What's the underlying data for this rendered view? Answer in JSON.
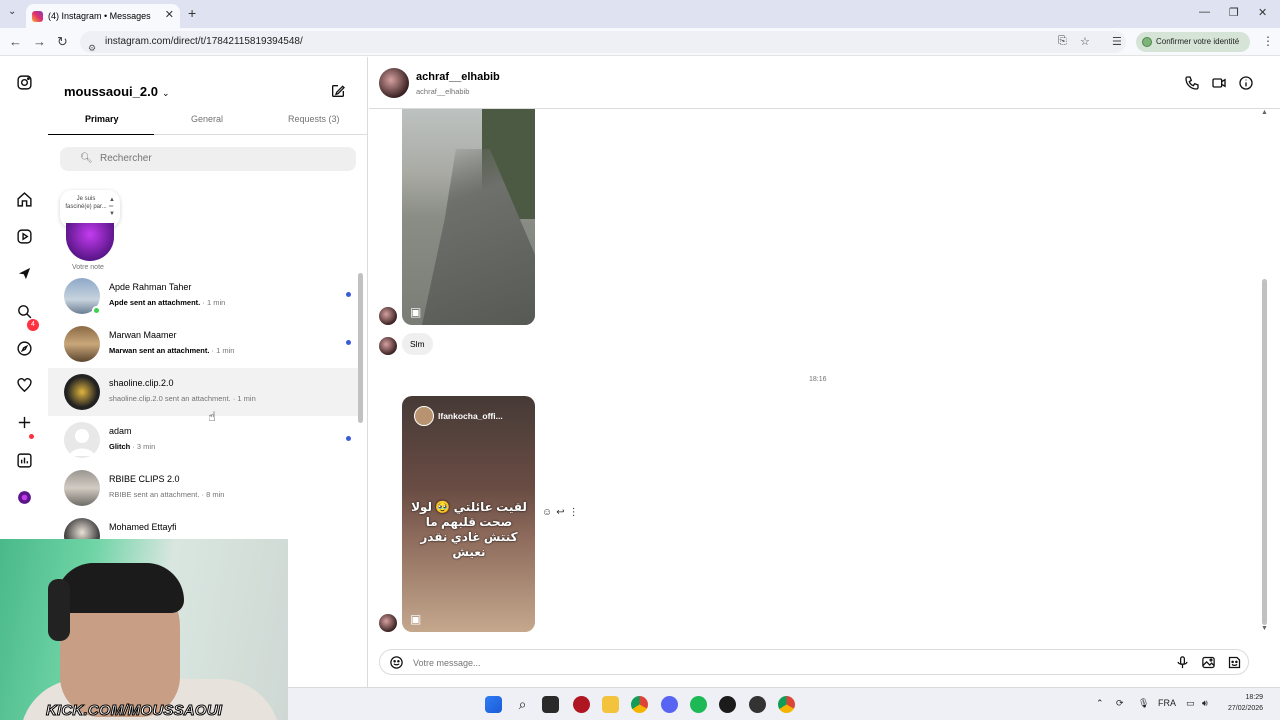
{
  "browser": {
    "tab_title": "(4) Instagram • Messages",
    "url": "instagram.com/direct/t/17842115819394548/",
    "confirm_identity": "Confirmer votre identité"
  },
  "sidebar": {
    "notification_count": "4",
    "icons": [
      "instagram-icon",
      "home-icon",
      "reels-icon",
      "messenger-icon",
      "search-icon",
      "explore-icon",
      "heart-icon",
      "create-icon",
      "dashboard-icon",
      "profile-icon"
    ]
  },
  "inbox": {
    "username": "moussaoui_2.0",
    "tabs": [
      "Primary",
      "General",
      "Requests (3)"
    ],
    "search_placeholder": "Rechercher",
    "note_text": "Je suis fasciné(e) par...",
    "note_label": "Votre note",
    "conversations": [
      {
        "name": "Apde Rahman Taher",
        "preview": "Apde sent an attachment.",
        "time": " · 1 min",
        "unread": true,
        "online": true
      },
      {
        "name": "Marwan Maamer",
        "preview": "Marwan sent an attachment.",
        "time": " · 1 min",
        "unread": true,
        "online": false
      },
      {
        "name": "shaoline.clip.2.0",
        "preview": "shaoline.clip.2.0 sent an attachment.",
        "time": " · 1 min",
        "unread": false,
        "online": false
      },
      {
        "name": "adam",
        "preview": "Glitch",
        "time": " · 3 min",
        "unread": true,
        "online": false
      },
      {
        "name": "RBIBE CLIPS 2.0",
        "preview": "RBIBE sent an attachment.",
        "time": " · 8 min",
        "unread": false,
        "online": false
      },
      {
        "name": "Mohamed Ettayfi",
        "preview": "",
        "time": "",
        "unread": false,
        "online": false
      }
    ]
  },
  "chat": {
    "contact_name": "achraf__elhabib",
    "contact_handle": "achraf__elhabib",
    "message_text": "Slm",
    "timestamp": "18:16",
    "reel2_account": "lfankocha_offi...",
    "reel2_caption": "لقيت عائلتي 🥹 لولا صحت قلبهم ما كنتش غادي نقدر نعيش",
    "composer_placeholder": "Votre message..."
  },
  "overlay": {
    "stream_text": "KICK.COM/MOUSSAOUI"
  },
  "taskbar": {
    "language": "FRA",
    "time": "18:29",
    "date": "27/02/2026"
  },
  "colors": {
    "unread_dot": "#3b5bdb",
    "notification_red": "#ff3040",
    "online_green": "#3bd14a"
  }
}
